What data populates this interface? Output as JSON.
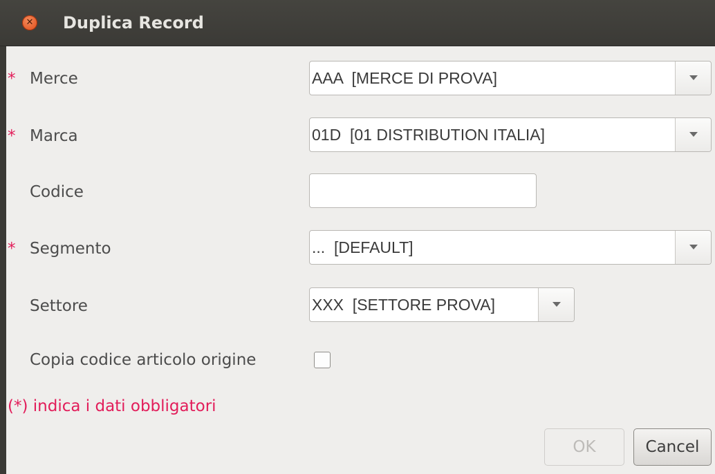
{
  "window": {
    "title": "Duplica Record"
  },
  "fields": {
    "merce": {
      "required_mark": "*",
      "label": "Merce",
      "value": "AAA  [MERCE DI PROVA]"
    },
    "marca": {
      "required_mark": "*",
      "label": "Marca",
      "value": "01D  [01 DISTRIBUTION ITALIA]"
    },
    "codice": {
      "label": "Codice",
      "value": ""
    },
    "segmento": {
      "required_mark": "*",
      "label": "Segmento",
      "value": "...  [DEFAULT]"
    },
    "settore": {
      "label": "Settore",
      "value": "XXX  [SETTORE PROVA]"
    },
    "copia": {
      "label": "Copia codice articolo origine",
      "checked": false
    }
  },
  "note": "(*) indica i dati obbligatori",
  "buttons": {
    "ok": "OK",
    "cancel": "Cancel"
  },
  "colors": {
    "required": "#e21d5a",
    "titlebar": "#3b3a36",
    "close": "#df4a17",
    "background": "#efeeec"
  }
}
